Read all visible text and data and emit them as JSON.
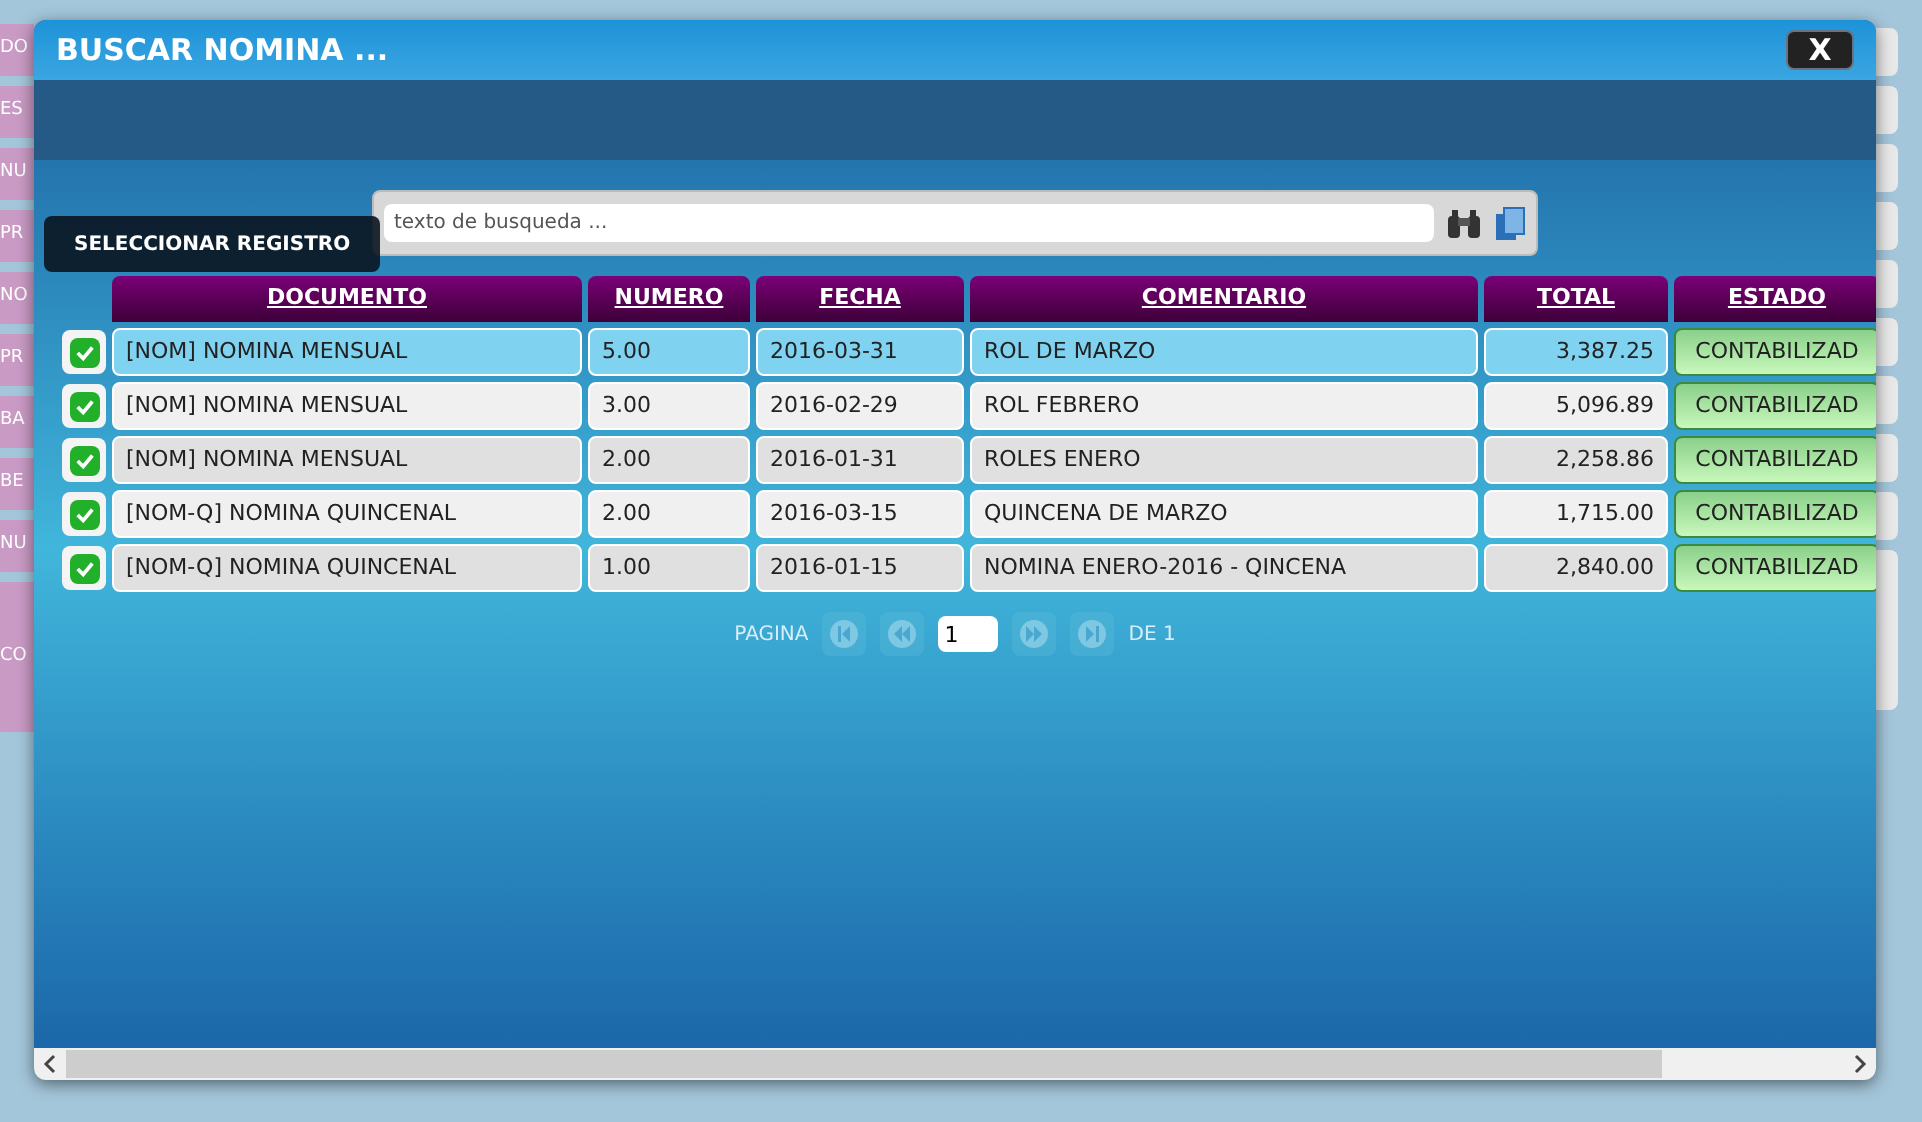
{
  "background_menu": [
    "DO",
    "ES",
    "NU",
    "PR",
    "NO",
    "PR",
    "BA",
    "BE",
    "NU",
    "CO"
  ],
  "dialog": {
    "title": "BUSCAR NOMINA ...",
    "close": "X"
  },
  "search": {
    "placeholder": "texto de busqueda ..."
  },
  "tooltip": "SELECCIONAR REGISTRO",
  "table": {
    "columns": [
      "DOCUMENTO",
      "NUMERO",
      "FECHA",
      "COMENTARIO",
      "TOTAL",
      "ESTADO"
    ],
    "rows": [
      {
        "selected": true,
        "checked": true,
        "cells": [
          "[NOM] NOMINA MENSUAL",
          "5.00",
          "2016-03-31",
          "ROL DE MARZO",
          "3,387.25",
          "CONTABILIZAD"
        ]
      },
      {
        "selected": false,
        "checked": true,
        "cells": [
          "[NOM] NOMINA MENSUAL",
          "3.00",
          "2016-02-29",
          "ROL FEBRERO",
          "5,096.89",
          "CONTABILIZAD"
        ]
      },
      {
        "selected": false,
        "checked": true,
        "cells": [
          "[NOM] NOMINA MENSUAL",
          "2.00",
          "2016-01-31",
          "ROLES ENERO",
          "2,258.86",
          "CONTABILIZAD"
        ]
      },
      {
        "selected": false,
        "checked": true,
        "cells": [
          "[NOM-Q] NOMINA QUINCENAL",
          "2.00",
          "2016-03-15",
          "QUINCENA DE MARZO",
          "1,715.00",
          "CONTABILIZAD"
        ]
      },
      {
        "selected": false,
        "checked": true,
        "cells": [
          "[NOM-Q] NOMINA QUINCENAL",
          "1.00",
          "2016-01-15",
          "NOMINA ENERO-2016 - QINCENA",
          "2,840.00",
          "CONTABILIZAD"
        ]
      }
    ]
  },
  "pager": {
    "label": "PAGINA",
    "page": "1",
    "of": "DE 1"
  }
}
